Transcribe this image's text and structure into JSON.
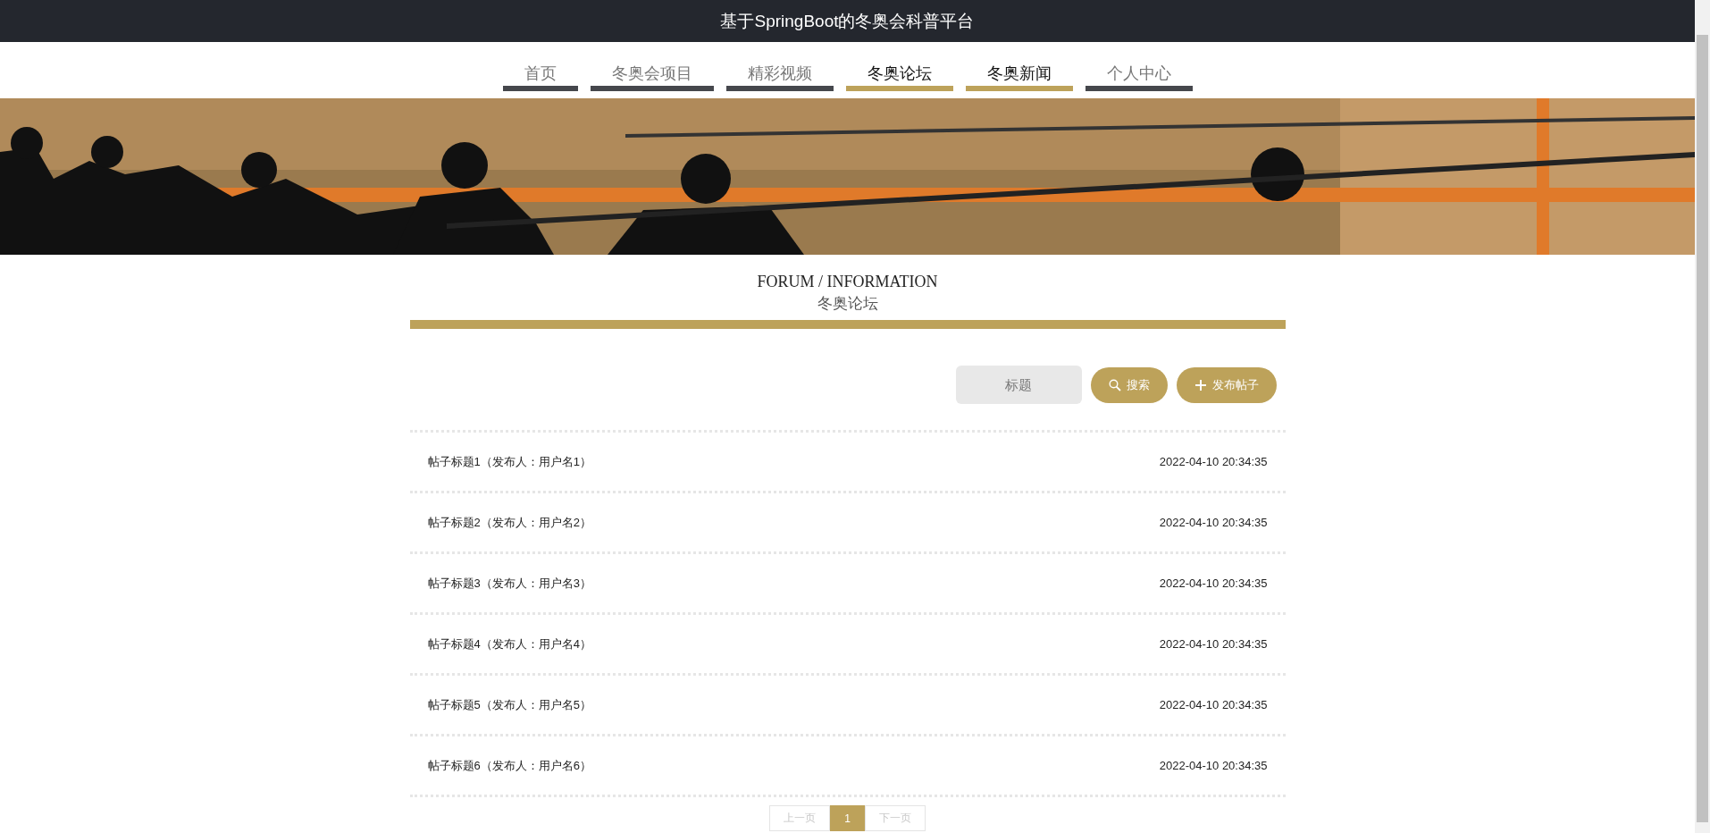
{
  "header": {
    "title": "基于SpringBoot的冬奥会科普平台"
  },
  "nav": [
    {
      "label": "首页",
      "highlighted": false
    },
    {
      "label": "冬奥会项目",
      "highlighted": false
    },
    {
      "label": "精彩视频",
      "highlighted": false
    },
    {
      "label": "冬奥论坛",
      "highlighted": true
    },
    {
      "label": "冬奥新闻",
      "highlighted": true
    },
    {
      "label": "个人中心",
      "highlighted": false
    }
  ],
  "section": {
    "title": "FORUM / INFORMATION",
    "subtitle": "冬奥论坛"
  },
  "toolbar": {
    "search": {
      "placeholder": "标题"
    },
    "search_button": "搜索",
    "add_button": "发布帖子"
  },
  "posts": [
    {
      "title": "帖子标题1（发布人：用户名1）",
      "time": "2022-04-10 20:34:35"
    },
    {
      "title": "帖子标题2（发布人：用户名2）",
      "time": "2022-04-10 20:34:35"
    },
    {
      "title": "帖子标题3（发布人：用户名3）",
      "time": "2022-04-10 20:34:35"
    },
    {
      "title": "帖子标题4（发布人：用户名4）",
      "time": "2022-04-10 20:34:35"
    },
    {
      "title": "帖子标题5（发布人：用户名5）",
      "time": "2022-04-10 20:34:35"
    },
    {
      "title": "帖子标题6（发布人：用户名6）",
      "time": "2022-04-10 20:34:35"
    }
  ],
  "pagination": {
    "prev": "上一页",
    "pages": [
      {
        "label": "1",
        "selected": true
      }
    ],
    "next": "下一页"
  }
}
